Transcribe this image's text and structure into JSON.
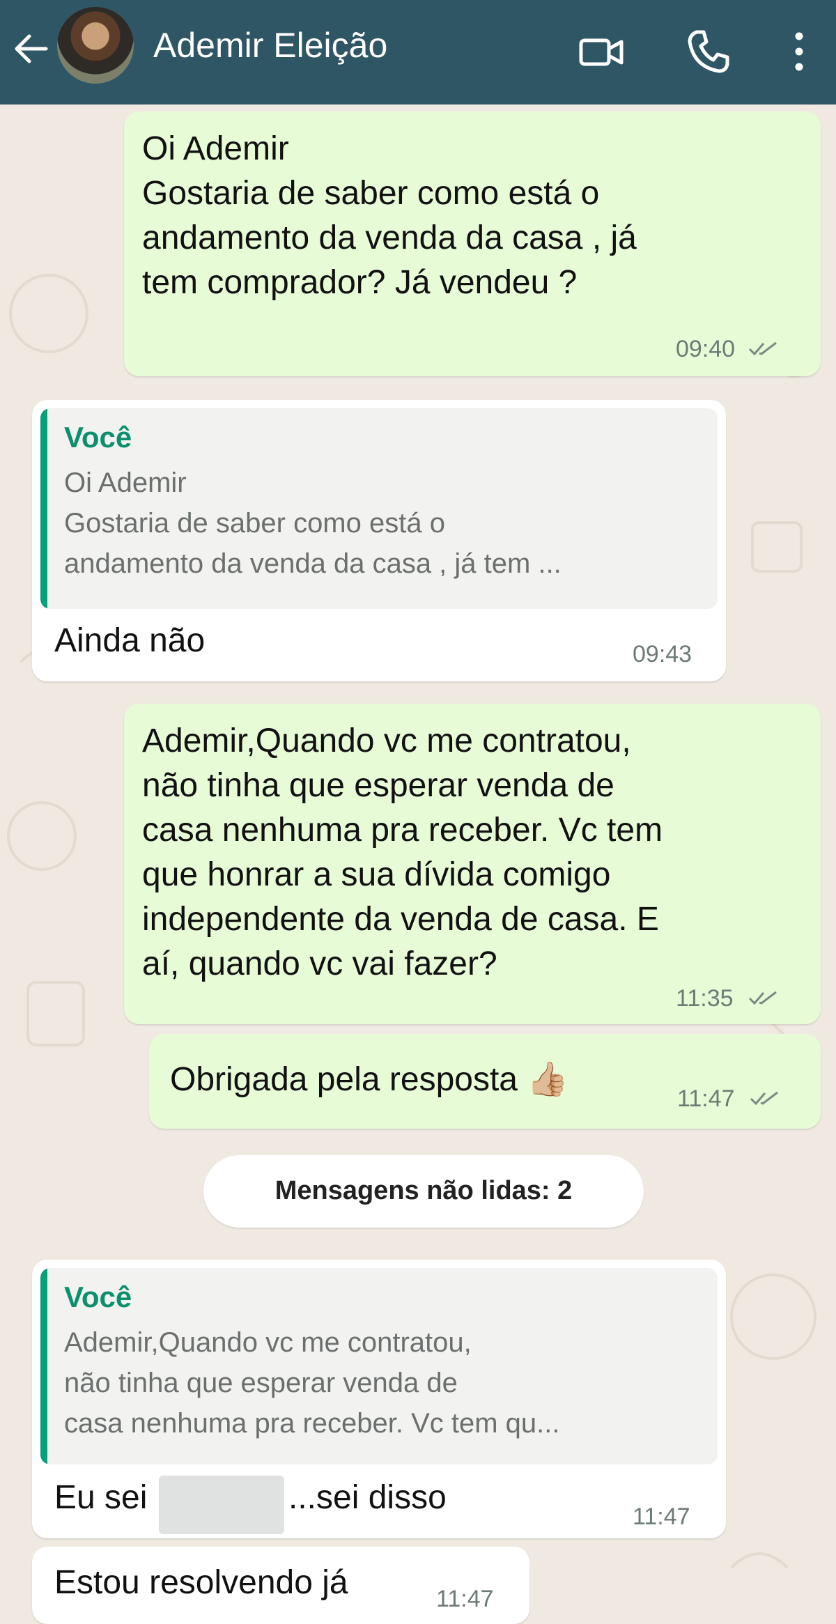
{
  "header": {
    "contact_name": "Ademir Eleição",
    "back_icon": "arrow-left-icon",
    "video_icon": "video-call-icon",
    "call_icon": "phone-icon",
    "menu_icon": "more-vertical-icon",
    "bg_color": "#2f5665"
  },
  "messages": [
    {
      "direction": "outgoing",
      "text": "Oi Ademir\nGostaria de saber como está o\nandamento da venda da casa , já\ntem comprador? Já vendeu ?",
      "time": "09:40",
      "status": "read"
    },
    {
      "direction": "incoming",
      "quote": {
        "author": "Você",
        "text": "Oi Ademir\nGostaria de saber como está o\nandamento da venda da casa , já tem ..."
      },
      "text": "Ainda não",
      "time": "09:43"
    },
    {
      "direction": "outgoing",
      "text": "Ademir,Quando vc me contratou,\nnão tinha que esperar venda de\ncasa nenhuma pra receber. Vc tem\nque honrar a sua dívida comigo\nindependente da venda de casa. E\naí, quando vc vai fazer?",
      "time": "11:35",
      "status": "read"
    },
    {
      "direction": "outgoing",
      "text": "Obrigada pela resposta 👍🏼",
      "time": "11:47",
      "status": "read"
    },
    {
      "direction": "incoming",
      "quote": {
        "author": "Você",
        "text": "Ademir,Quando vc me contratou,\nnão tinha que esperar venda de\ncasa nenhuma pra receber. Vc tem qu..."
      },
      "text_before": "Eu sei",
      "text_after": "...sei disso",
      "time": "11:47"
    },
    {
      "direction": "incoming",
      "text": "Estou resolvendo já",
      "time": "11:47"
    }
  ],
  "unread_label": "Mensagens não lidas: 2",
  "colors": {
    "outgoing_bubble": "#e6fbd6",
    "incoming_bubble": "#ffffff",
    "accent": "#0b8f6c",
    "wallpaper": "#efe9e1"
  }
}
